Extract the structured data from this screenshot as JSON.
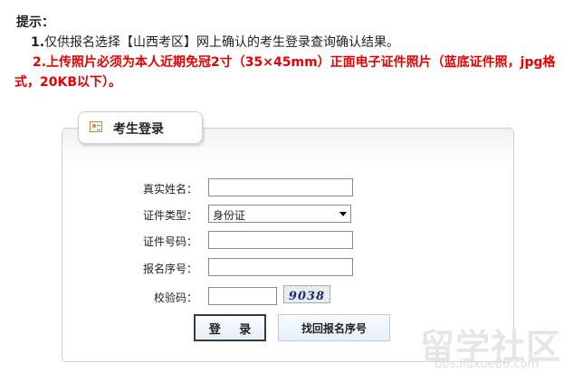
{
  "notice": {
    "title": "提示：",
    "line1_num": "1.",
    "line1_text": "仅供报名选择【山西考区】网上确认的考生登录查询确认结果。",
    "line2_text": "2.上传照片必须为本人近期免冠2寸（35×45mm）正面电子证件照片（蓝底证件照，jpg格式，20KB以下）。"
  },
  "panel": {
    "tab_label": "考生登录",
    "tab_icon": "id-card-icon"
  },
  "form": {
    "name_label": "真实姓名：",
    "name_value": "",
    "idtype_label": "证件类型：",
    "idtype_value": "身份证",
    "idnum_label": "证件号码：",
    "idnum_value": "",
    "regno_label": "报名序号：",
    "regno_value": "",
    "captcha_label": "校验码：",
    "captcha_value": "",
    "captcha_image_text": "9038"
  },
  "buttons": {
    "login": "登 录",
    "retrieve": "找回报名序号"
  },
  "watermark": {
    "main": "留学社区",
    "url": "bbs.liuxue86.com"
  },
  "colors": {
    "warning": "#e60000",
    "text": "#222222"
  }
}
